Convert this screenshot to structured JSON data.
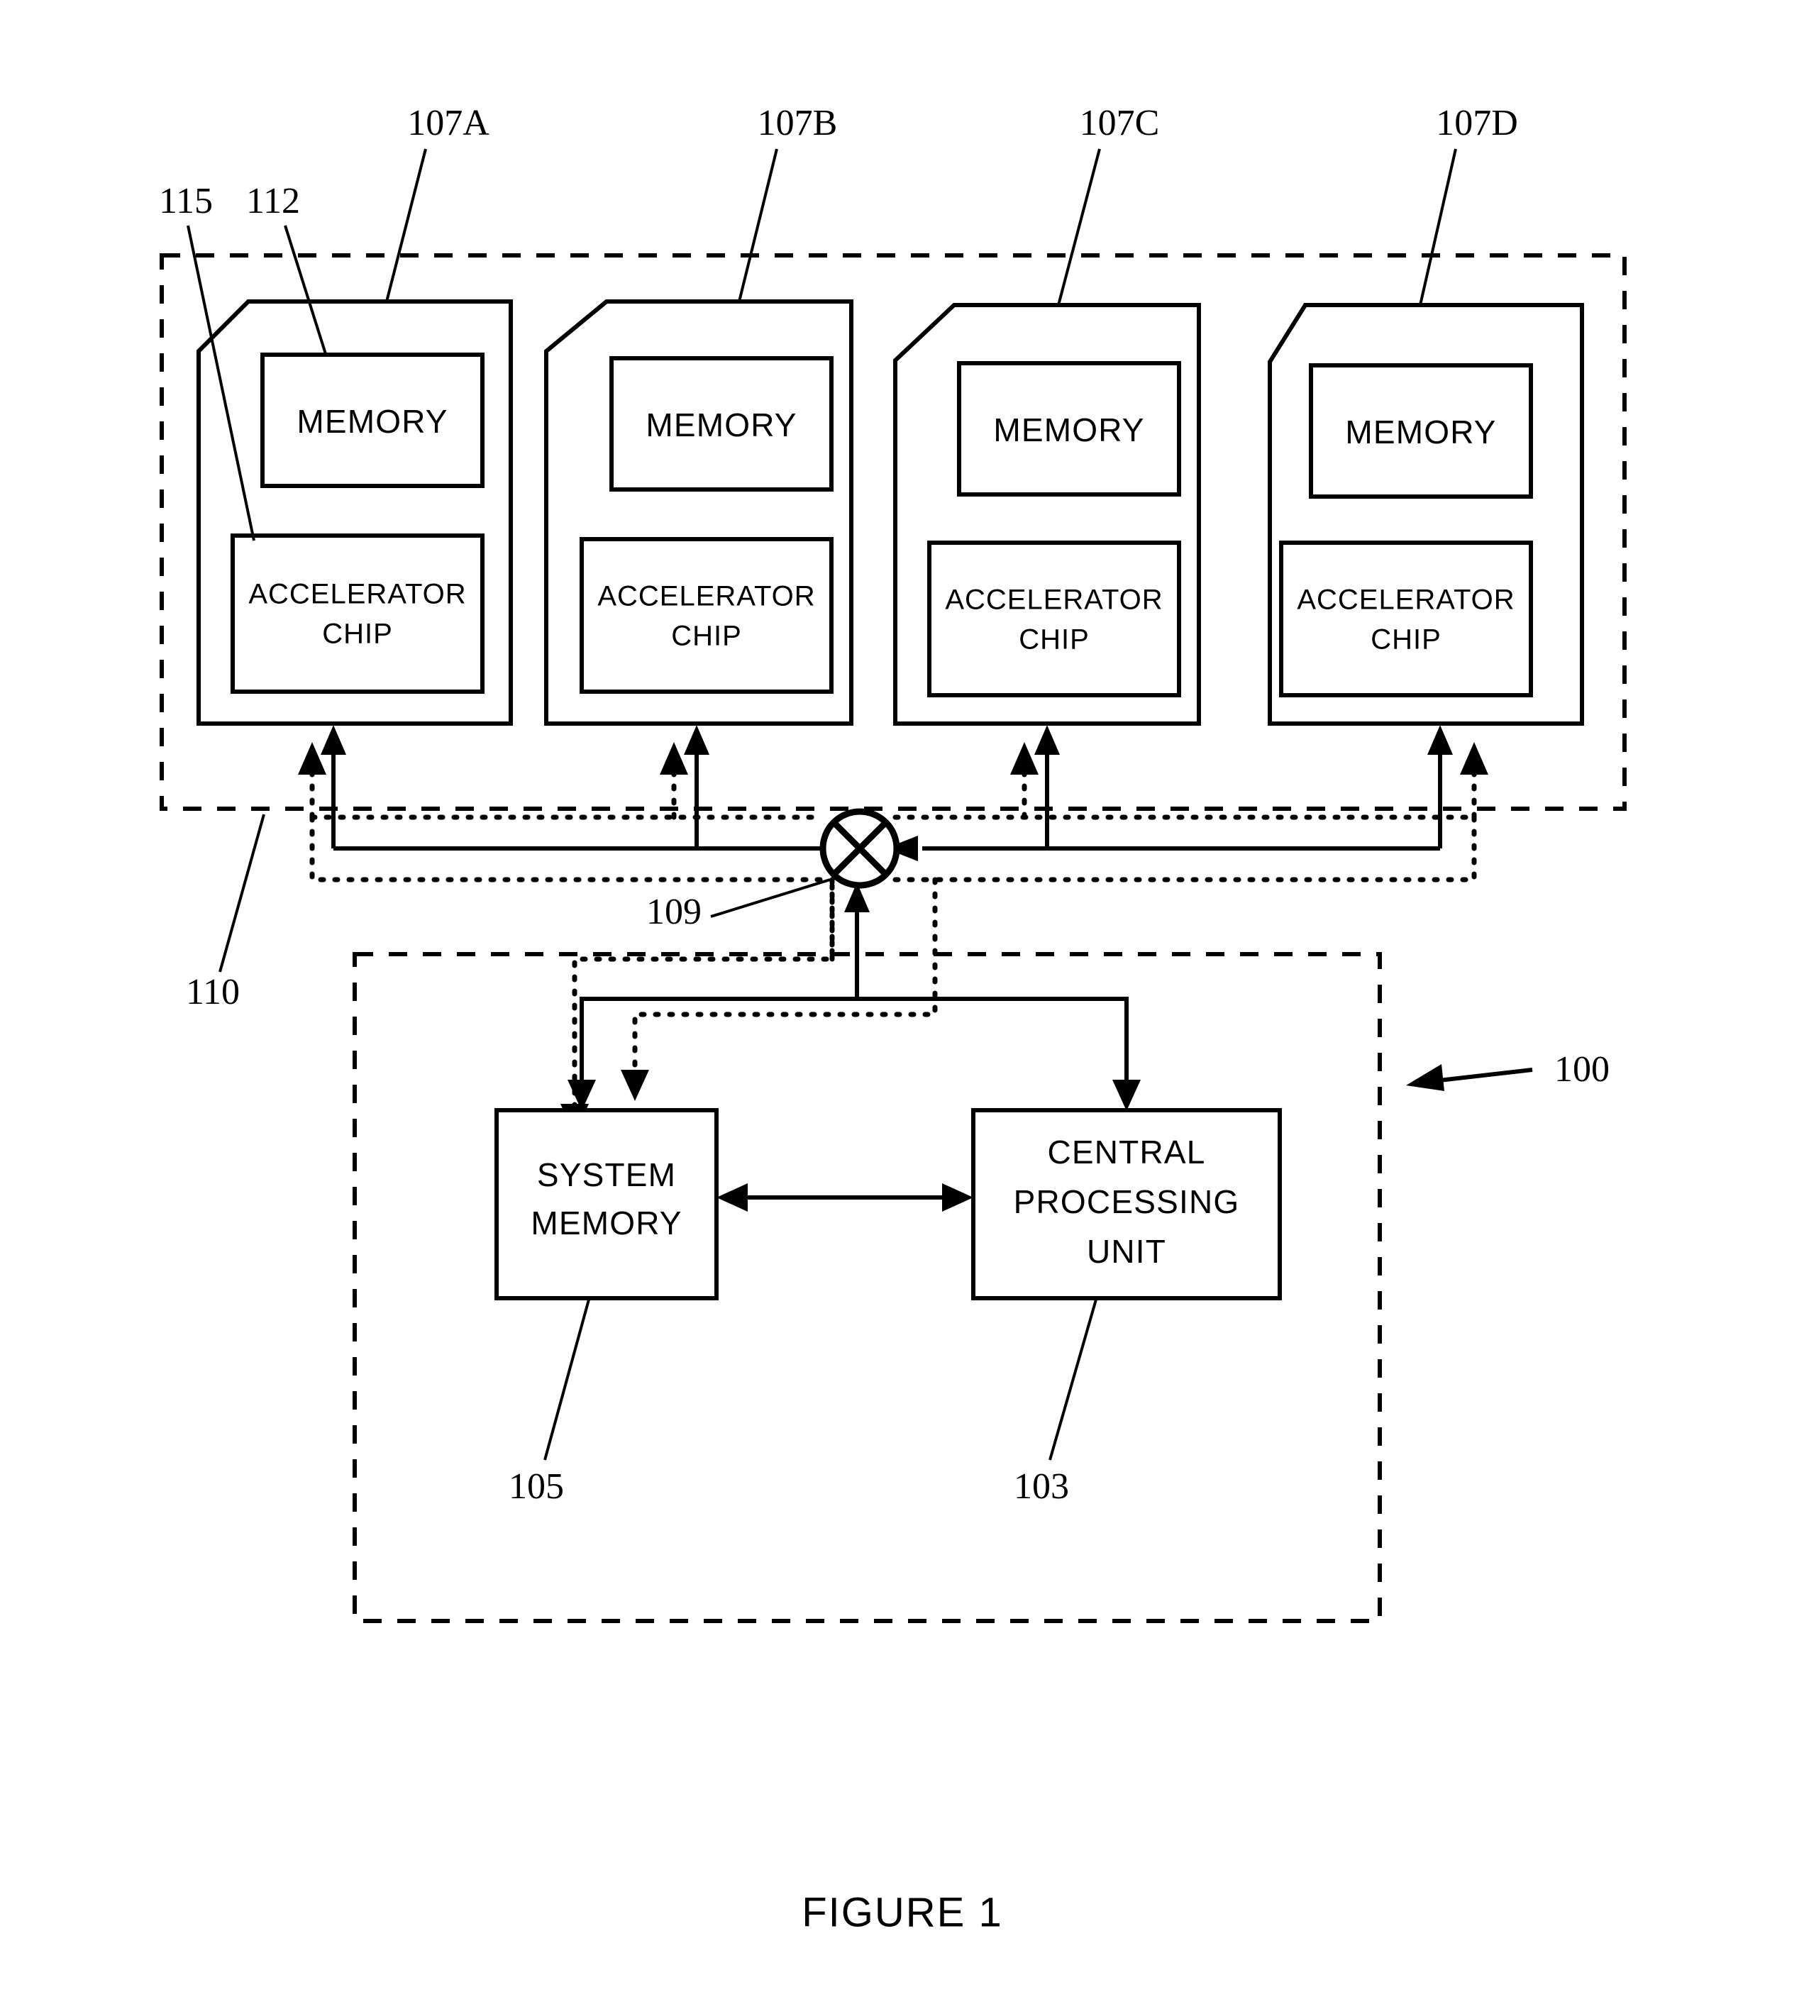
{
  "figure": {
    "caption": "FIGURE 1",
    "system_ref": "100"
  },
  "accelerator_enclosure": {
    "ref": "110",
    "style": "dashed-boundary"
  },
  "accelerator_cards": [
    {
      "ref": "107A",
      "card_ref": "115",
      "memory_ref": "112",
      "memory_label": "MEMORY",
      "chip_label_line1": "ACCELERATOR",
      "chip_label_line2": "CHIP"
    },
    {
      "ref": "107B",
      "memory_label": "MEMORY",
      "chip_label_line1": "ACCELERATOR",
      "chip_label_line2": "CHIP"
    },
    {
      "ref": "107C",
      "memory_label": "MEMORY",
      "chip_label_line1": "ACCELERATOR",
      "chip_label_line2": "CHIP"
    },
    {
      "ref": "107D",
      "memory_label": "MEMORY",
      "chip_label_line1": "ACCELERATOR",
      "chip_label_line2": "CHIP"
    }
  ],
  "switch": {
    "ref": "109",
    "icon": "crossed-circle-switch-icon"
  },
  "host": {
    "boundary_style": "dashed-boundary",
    "system_memory": {
      "ref": "105",
      "label_line1": "SYSTEM",
      "label_line2": "MEMORY"
    },
    "cpu": {
      "ref": "103",
      "label_line1": "CENTRAL",
      "label_line2": "PROCESSING",
      "label_line3": "UNIT"
    }
  },
  "colors": {
    "ink": "#000000",
    "paper": "#ffffff"
  }
}
